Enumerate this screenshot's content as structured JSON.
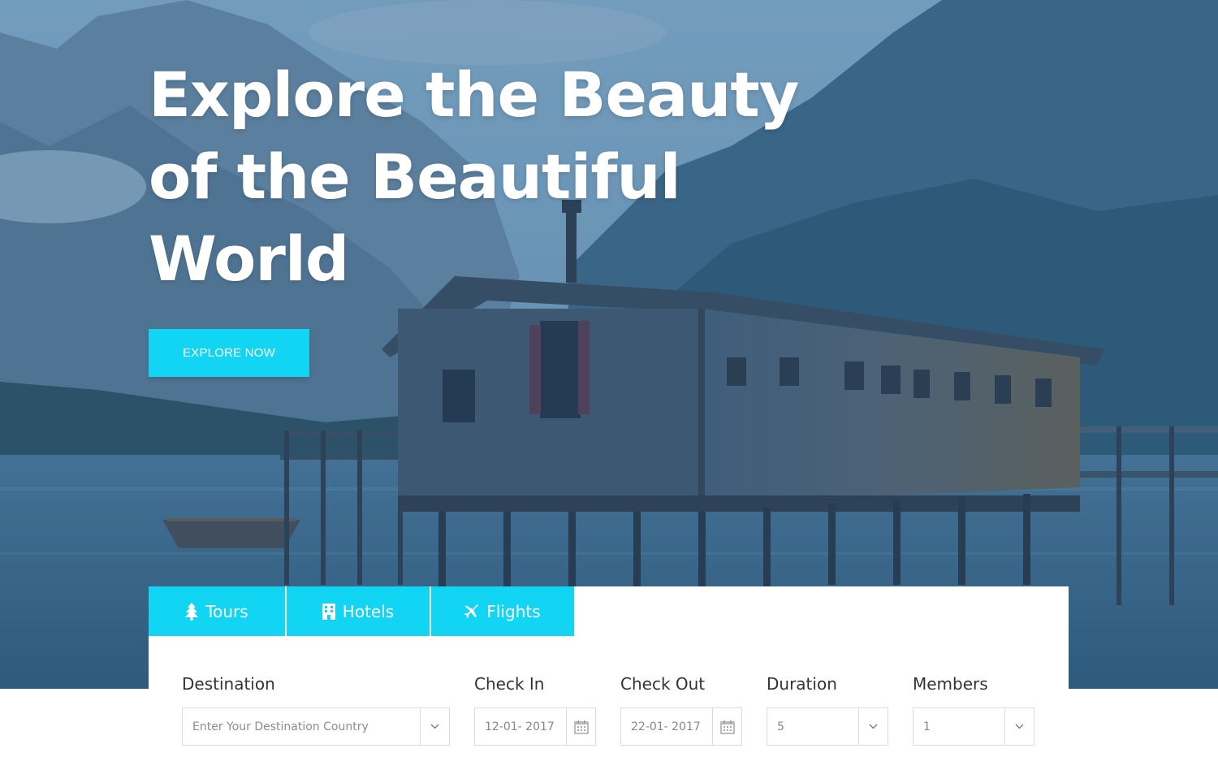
{
  "hero": {
    "title_line1": "Explore the Beauty",
    "title_line2": "of the Beautiful",
    "title_line3": "World",
    "cta_label": "EXPLORE NOW"
  },
  "tabs": [
    {
      "label": "Tours",
      "icon": "tree-icon"
    },
    {
      "label": "Hotels",
      "icon": "building-icon"
    },
    {
      "label": "Flights",
      "icon": "plane-icon"
    }
  ],
  "search": {
    "destination": {
      "label": "Destination",
      "placeholder": "Enter Your Destination Country"
    },
    "check_in": {
      "label": "Check In",
      "value": "12-01- 2017"
    },
    "check_out": {
      "label": "Check Out",
      "value": "22-01- 2017"
    },
    "duration": {
      "label": "Duration",
      "value": "5"
    },
    "members": {
      "label": "Members",
      "value": "1"
    }
  },
  "colors": {
    "accent": "#12d4f3",
    "overlay": "#2f5677",
    "text": "#333333"
  }
}
